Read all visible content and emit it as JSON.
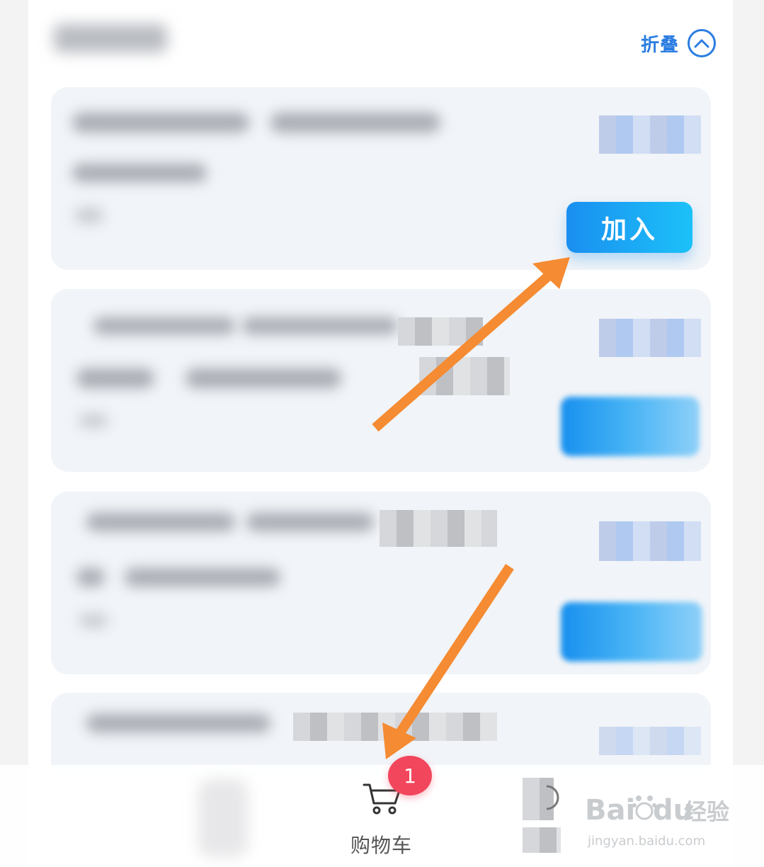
{
  "header": {
    "collapse_label": "折叠",
    "collapse_icon": "chevron-up-icon"
  },
  "cards": [
    {
      "add_label": "加入"
    }
  ],
  "cart": {
    "label": "购物车",
    "badge_count": "1",
    "icon": "cart-icon"
  },
  "watermark": {
    "brand": "Bai",
    "brand_tail": "du",
    "suffix": "经验",
    "url": "jingyan.baidu.com"
  },
  "annotations": {
    "arrow_color": "#f58b32"
  }
}
